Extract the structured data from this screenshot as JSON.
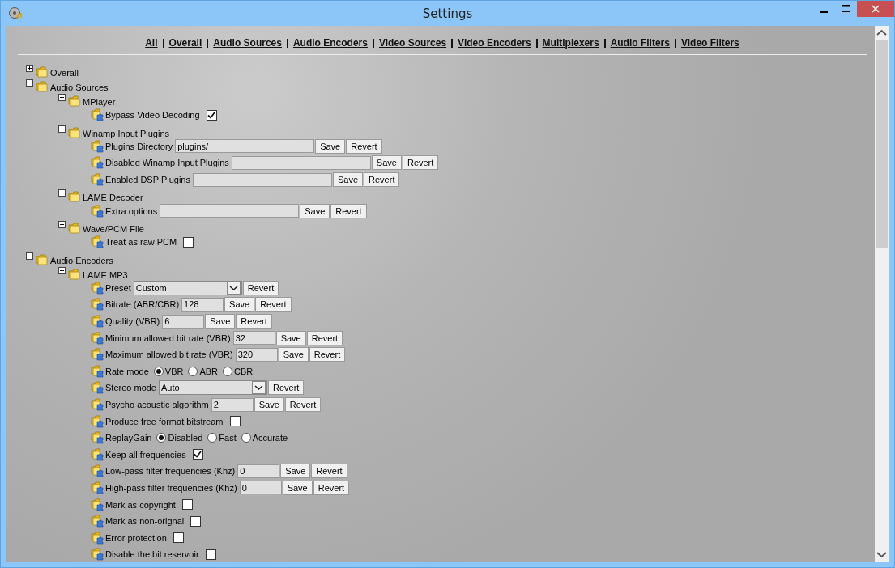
{
  "window": {
    "title": "Settings"
  },
  "nav": [
    {
      "label": "All"
    },
    {
      "label": "Overall"
    },
    {
      "label": "Audio Sources"
    },
    {
      "label": "Audio Encoders"
    },
    {
      "label": "Video Sources"
    },
    {
      "label": "Video Encoders"
    },
    {
      "label": "Multiplexers"
    },
    {
      "label": "Audio Filters"
    },
    {
      "label": "Video Filters"
    }
  ],
  "tree": [
    {
      "kind": "folder",
      "label": "Overall",
      "expanded": false
    },
    {
      "kind": "folder",
      "label": "Audio Sources",
      "expanded": true,
      "children": [
        {
          "kind": "folder",
          "label": "MPlayer",
          "expanded": true,
          "children": [
            {
              "kind": "checkbox",
              "label": "Bypass Video Decoding",
              "checked": true
            }
          ]
        },
        {
          "kind": "folder",
          "label": "Winamp Input Plugins",
          "expanded": true,
          "children": [
            {
              "kind": "text",
              "label": "Plugins Directory",
              "value": "plugins/",
              "buttons": [
                "Save",
                "Revert"
              ]
            },
            {
              "kind": "text",
              "label": "Disabled Winamp Input Plugins",
              "buttons": [
                "Save",
                "Revert"
              ]
            },
            {
              "kind": "text",
              "label": "Enabled DSP Plugins",
              "buttons": [
                "Save",
                "Revert"
              ]
            }
          ]
        },
        {
          "kind": "folder",
          "label": "LAME Decoder",
          "expanded": true,
          "children": [
            {
              "kind": "text",
              "label": "Extra options",
              "buttons": [
                "Save",
                "Revert"
              ]
            }
          ]
        },
        {
          "kind": "folder",
          "label": "Wave/PCM File",
          "expanded": true,
          "children": [
            {
              "kind": "checkbox",
              "label": "Treat as raw PCM",
              "checked": false
            }
          ]
        }
      ]
    },
    {
      "kind": "folder",
      "label": "Audio Encoders",
      "expanded": true,
      "children": [
        {
          "kind": "folder",
          "label": "LAME MP3",
          "expanded": true,
          "children": [
            {
              "kind": "select",
              "label": "Preset",
              "value": "Custom",
              "buttons": [
                "Revert"
              ]
            },
            {
              "kind": "number",
              "label": "Bitrate (ABR/CBR)",
              "value": "128",
              "buttons": [
                "Save",
                "Revert"
              ]
            },
            {
              "kind": "number",
              "label": "Quality (VBR)",
              "value": "6",
              "buttons": [
                "Save",
                "Revert"
              ]
            },
            {
              "kind": "number",
              "label": "Minimum allowed bit rate (VBR)",
              "value": "32",
              "buttons": [
                "Save",
                "Revert"
              ]
            },
            {
              "kind": "number",
              "label": "Maximum allowed bit rate (VBR)",
              "value": "320",
              "buttons": [
                "Save",
                "Revert"
              ]
            },
            {
              "kind": "radio",
              "label": "Rate mode",
              "options": [
                {
                  "label": "VBR",
                  "selected": true
                },
                {
                  "label": "ABR",
                  "selected": false
                },
                {
                  "label": "CBR",
                  "selected": false
                }
              ]
            },
            {
              "kind": "select",
              "label": "Stereo mode",
              "value": "Auto",
              "buttons": [
                "Revert"
              ]
            },
            {
              "kind": "number",
              "label": "Psycho acoustic algorithm",
              "value": "2",
              "buttons": [
                "Save",
                "Revert"
              ]
            },
            {
              "kind": "checkbox",
              "label": "Produce free format bitstream",
              "checked": false
            },
            {
              "kind": "radio",
              "label": "ReplayGain",
              "options": [
                {
                  "label": "Disabled",
                  "selected": true
                },
                {
                  "label": "Fast",
                  "selected": false
                },
                {
                  "label": "Accurate",
                  "selected": false
                }
              ]
            },
            {
              "kind": "checkbox",
              "label": "Keep all frequencies",
              "checked": true
            },
            {
              "kind": "number",
              "label": "Low-pass filter frequencies (Khz)",
              "value": "0",
              "buttons": [
                "Save",
                "Revert"
              ]
            },
            {
              "kind": "number",
              "label": "High-pass filter frequencies (Khz)",
              "value": "0",
              "buttons": [
                "Save",
                "Revert"
              ]
            },
            {
              "kind": "checkbox",
              "label": "Mark as copyright",
              "checked": false
            },
            {
              "kind": "checkbox",
              "label": "Mark as non-orignal",
              "checked": false
            },
            {
              "kind": "checkbox",
              "label": "Error protection",
              "checked": false
            },
            {
              "kind": "checkbox",
              "label": "Disable the bit reservoir",
              "checked": false
            }
          ]
        }
      ]
    }
  ]
}
